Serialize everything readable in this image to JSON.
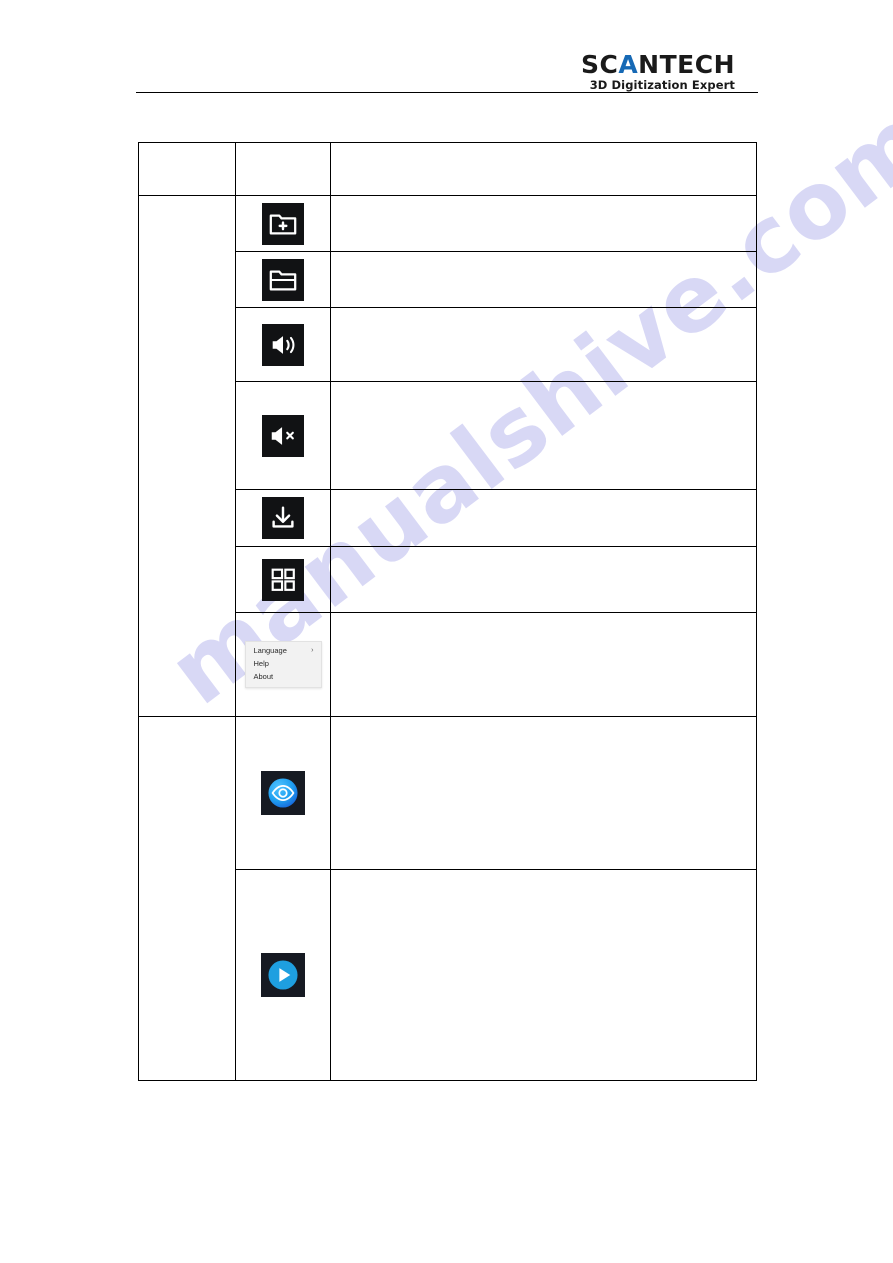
{
  "header": {
    "logo_word_part1": "SC",
    "logo_word_accent": "A",
    "logo_word_part2": "NTECH",
    "logo_tagline": "3D Digitization Expert",
    "accent_color": "#1669b5"
  },
  "watermark": {
    "text": "manualshive.com",
    "color": "#b9b9ee"
  },
  "table": {
    "headers": {
      "category": "",
      "icon": "",
      "description": ""
    },
    "groups": [
      {
        "category_label": "",
        "rows": [
          {
            "icon": "folder-add-icon",
            "description": ""
          },
          {
            "icon": "folder-open-icon",
            "description": ""
          },
          {
            "icon": "volume-on-icon",
            "description": ""
          },
          {
            "icon": "volume-mute-icon",
            "description": ""
          },
          {
            "icon": "download-icon",
            "description": ""
          },
          {
            "icon": "grid-view-icon",
            "description": ""
          },
          {
            "icon": "context-menu",
            "description": "",
            "menu": {
              "items": [
                {
                  "label": "Language",
                  "has_submenu": true,
                  "submenu_arrow": "›"
                },
                {
                  "label": "Help",
                  "has_submenu": false,
                  "submenu_arrow": ""
                },
                {
                  "label": "About",
                  "has_submenu": false,
                  "submenu_arrow": ""
                }
              ]
            }
          }
        ]
      },
      {
        "category_label": "",
        "rows": [
          {
            "icon": "eye-preview-icon",
            "description": ""
          },
          {
            "icon": "play-start-icon",
            "description": ""
          }
        ]
      }
    ]
  }
}
